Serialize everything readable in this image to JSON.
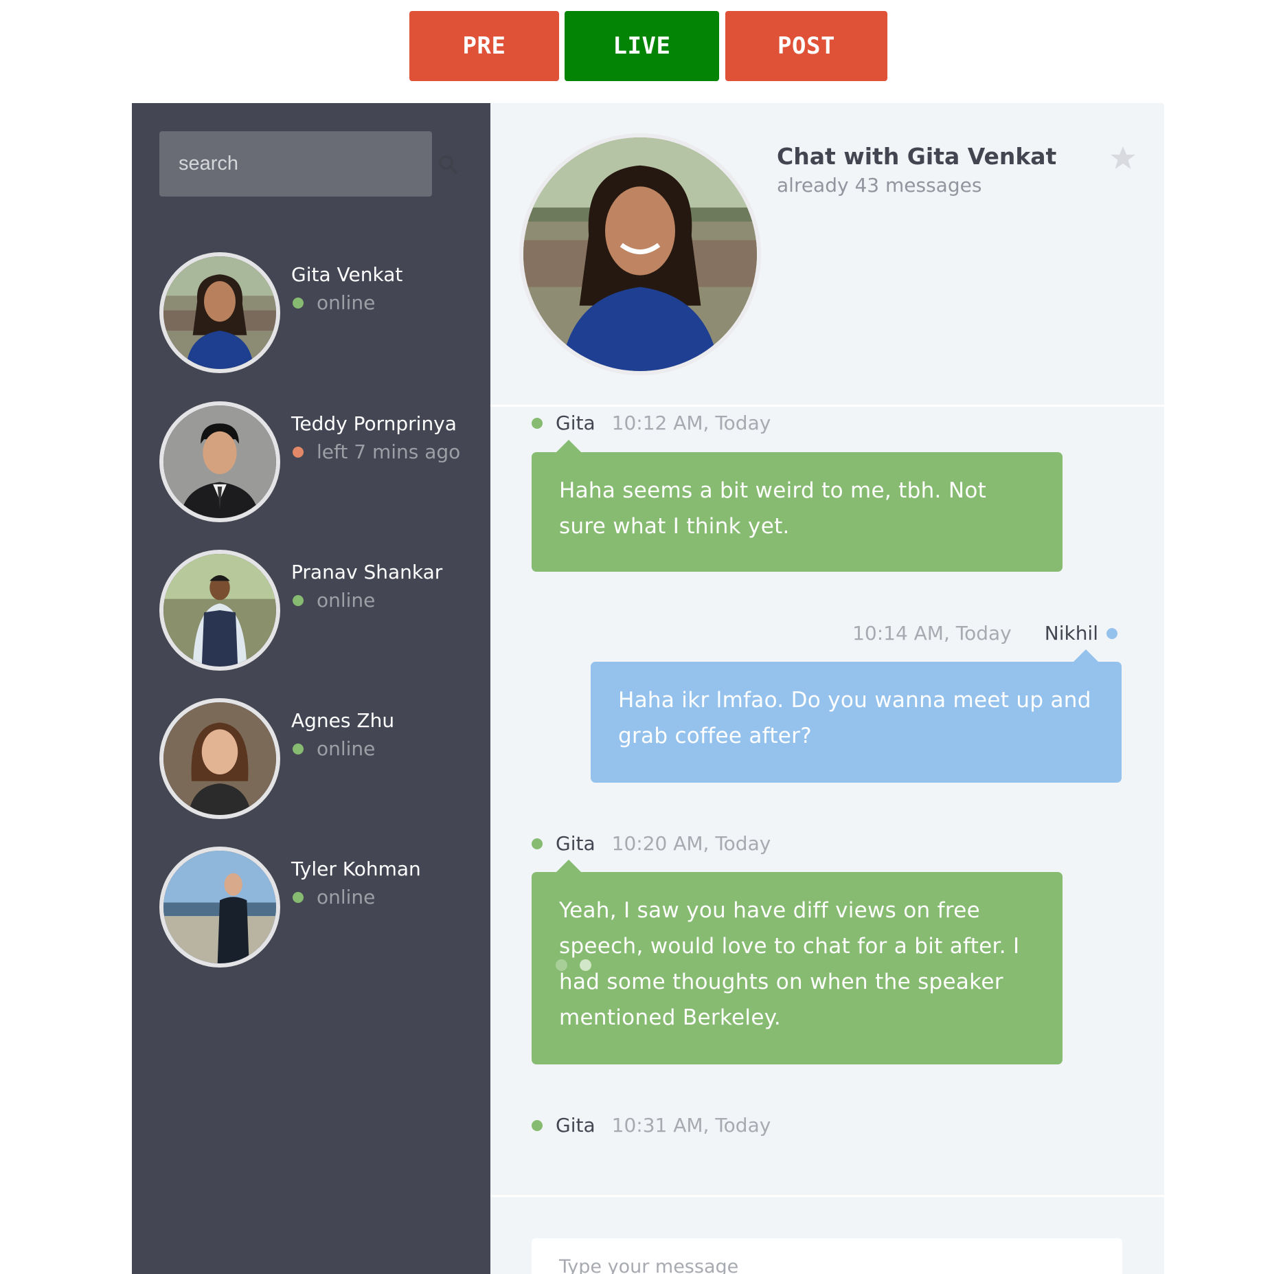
{
  "phases": {
    "pre": "PRE",
    "live": "LIVE",
    "post": "POST",
    "colors": {
      "pre": "#df5238",
      "live": "#048404",
      "post": "#df5238"
    }
  },
  "sidebar": {
    "search": {
      "placeholder": "search",
      "icon": "search-icon"
    },
    "contacts": [
      {
        "name": "Gita Venkat",
        "status": "online",
        "status_kind": "online"
      },
      {
        "name": "Teddy Pornprinya",
        "status": "left 7 mins ago",
        "status_kind": "away"
      },
      {
        "name": "Pranav Shankar",
        "status": "online",
        "status_kind": "online"
      },
      {
        "name": "Agnes Zhu",
        "status": "online",
        "status_kind": "online"
      },
      {
        "name": "Tyler Kohman",
        "status": "online",
        "status_kind": "online"
      }
    ]
  },
  "chat": {
    "title": "Chat with Gita Venkat",
    "subtitle": "already 43 messages",
    "star_icon": "star-icon",
    "messages": [
      {
        "sender": "Gita",
        "time": "10:12 AM, Today",
        "text": "Haha seems a bit weird to me, tbh. Not sure what I think yet.",
        "side": "other"
      },
      {
        "sender": "Nikhil",
        "time": "10:14 AM, Today",
        "text": "Haha ikr lmfao. Do you wanna meet up and grab coffee after?",
        "side": "me"
      },
      {
        "sender": "Gita",
        "time": "10:20 AM, Today",
        "text": "Yeah, I saw you have diff views on free speech, would love to chat for a bit after. I had some thoughts on when the speaker mentioned Berkeley.",
        "side": "other"
      }
    ],
    "typing": {
      "sender": "Gita",
      "time": "10:31 AM, Today"
    },
    "composer": {
      "placeholder": "Type your message"
    }
  },
  "colors": {
    "sidebar_bg": "#444753",
    "chat_bg": "#f2f5f8",
    "bubble_other": "#86bb71",
    "bubble_me": "#94c2ed",
    "online": "#86bb71",
    "away": "#e38968"
  }
}
